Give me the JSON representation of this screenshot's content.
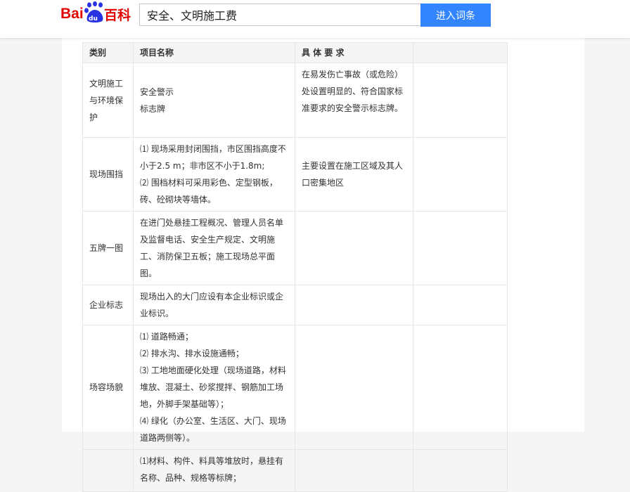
{
  "header": {
    "logo_text": "Bai du 百科",
    "search_value": "安全、文明施工费",
    "search_button": "进入词条"
  },
  "table": {
    "headers": [
      "类别",
      "项目名称",
      "具 体 要 求",
      ""
    ],
    "rows": [
      {
        "category": "文明施工与环境保护",
        "item_lines": [
          "安全警示",
          "标志牌"
        ],
        "requirement": "在易发伤亡事故（或危险）处设置明显的、符合国家标准要求的安全警示标志牌。",
        "extra": ""
      },
      {
        "category": "现场围挡",
        "item_lines": [
          "⑴ 现场采用封闭围挡，市区围挡高度不小于2.5 m；非市区不小于1.8m;",
          "⑵ 围档材料可采用彩色、定型钢板，砖、砼砌块等墙体。"
        ],
        "requirement": "主要设置在施工区域及其人口密集地区",
        "extra": ""
      },
      {
        "category": "五牌一图",
        "item_lines": [
          "在进门处悬挂工程概况、管理人员名单及监督电话、安全生产规定、文明施工、消防保卫五板；施工现场总平面图。"
        ],
        "requirement": "",
        "extra": ""
      },
      {
        "category": "企业标志",
        "item_lines": [
          "现场出入的大门应设有本企业标识或企业标识。"
        ],
        "requirement": "",
        "extra": ""
      },
      {
        "category": "场容场貌",
        "item_lines": [
          "⑴ 道路畅通；",
          "⑵ 排水沟、排水设施通畅；",
          "⑶ 工地地面硬化处理（现场道路，材料堆放、混凝土、砂浆搅拌、钢筋加工场地，外脚手架基础等）；",
          "⑷ 绿化（办公室、生活区、大门、现场道路两侧等）。"
        ],
        "requirement": "",
        "extra": ""
      },
      {
        "category": "",
        "item_lines": [
          "⑴材料、构件、料具等堆放时，悬挂有名称、品种、规格等标牌；"
        ],
        "requirement": "",
        "extra": ""
      }
    ]
  }
}
